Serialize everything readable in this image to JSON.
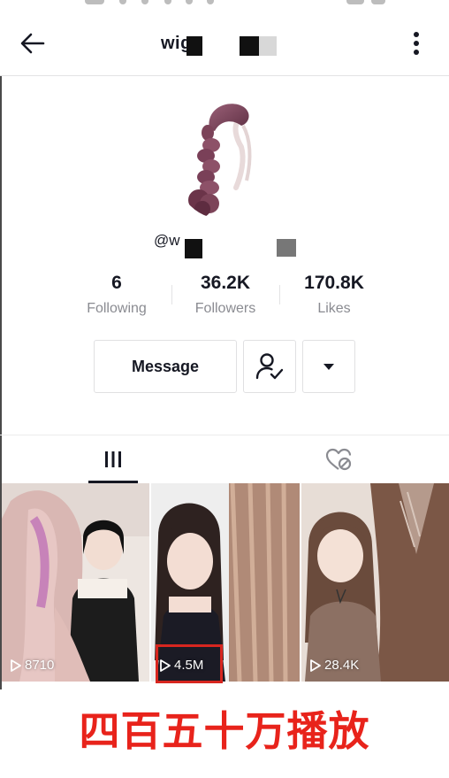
{
  "header": {
    "title": "wig",
    "back_icon": "arrow-left-icon",
    "more_icon": "more-vertical-icon"
  },
  "profile": {
    "username": "@w",
    "avatar_icon": "braided-hair-avatar"
  },
  "stats": [
    {
      "value": "6",
      "label": "Following"
    },
    {
      "value": "36.2K",
      "label": "Followers"
    },
    {
      "value": "170.8K",
      "label": "Likes"
    }
  ],
  "actions": {
    "message_label": "Message",
    "follow_icon": "user-check-icon",
    "dropdown_icon": "caret-down-icon"
  },
  "tabs": [
    {
      "name": "videos",
      "icon": "grid-bars-icon",
      "active": true
    },
    {
      "name": "liked",
      "icon": "liked-hidden-icon",
      "active": false
    }
  ],
  "videos": [
    {
      "plays": "8710"
    },
    {
      "plays": "4.5M"
    },
    {
      "plays": "28.4K"
    }
  ],
  "annotation": {
    "text": "四百五十万播放",
    "color": "#e8231b"
  }
}
